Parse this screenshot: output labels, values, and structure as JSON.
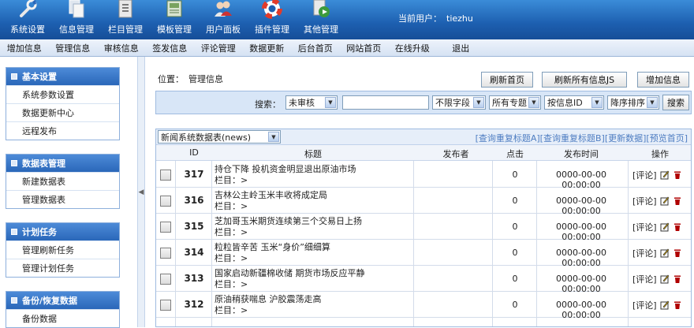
{
  "top_nav": [
    {
      "label": "系统设置",
      "icon": "wrench-icon"
    },
    {
      "label": "信息管理",
      "icon": "documents-icon"
    },
    {
      "label": "栏目管理",
      "icon": "column-icon"
    },
    {
      "label": "模板管理",
      "icon": "template-icon"
    },
    {
      "label": "用户面板",
      "icon": "users-icon"
    },
    {
      "label": "插件管理",
      "icon": "lifebuoy-icon"
    },
    {
      "label": "其他管理",
      "icon": "media-icon"
    }
  ],
  "user": {
    "label": "当前用户：",
    "name": "tiezhu"
  },
  "sub_menu": [
    "增加信息",
    "管理信息",
    "审核信息",
    "签发信息",
    "评论管理",
    "数据更新",
    "后台首页",
    "网站首页",
    "在线升级",
    "退出"
  ],
  "sidebar": [
    {
      "title": "基本设置",
      "items": [
        "系统参数设置",
        "数据更新中心",
        "远程发布"
      ]
    },
    {
      "title": "数据表管理",
      "items": [
        "新建数据表",
        "管理数据表"
      ]
    },
    {
      "title": "计划任务",
      "items": [
        "管理刷新任务",
        "管理计划任务"
      ]
    },
    {
      "title": "备份/恢复数据",
      "items": [
        "备份数据"
      ]
    }
  ],
  "breadcrumb": {
    "label": "位置：",
    "current": "管理信息"
  },
  "actions": {
    "refresh_home": "刷新首页",
    "refresh_js": "刷新所有信息JS",
    "add_info": "增加信息"
  },
  "search": {
    "label": "搜索：",
    "status": "未审核",
    "query": "",
    "field": "不限字段",
    "topic": "所有专题",
    "sort_by": "按信息ID",
    "order": "降序排序",
    "button": "搜索"
  },
  "table_select": "新闻系统数据表(news)",
  "panel_links": [
    "[查询重复标题A]",
    "[查询重复标题B]",
    "[更新数据]",
    "[预览首页]"
  ],
  "columns": {
    "id": "ID",
    "title": "标题",
    "author": "发布者",
    "clicks": "点击",
    "time": "发布时间",
    "ops": "操作"
  },
  "rows": [
    {
      "id": "317",
      "title": "持仓下降 投机资金明显退出原油市场",
      "column": "栏目：>",
      "clicks": "0",
      "time": "0000-00-00 00:00:00",
      "comment": "[评论]"
    },
    {
      "id": "316",
      "title": "吉林公主岭玉米丰收将成定局",
      "column": "栏目：>",
      "clicks": "0",
      "time": "0000-00-00 00:00:00",
      "comment": "[评论]"
    },
    {
      "id": "315",
      "title": "芝加哥玉米期货连续第三个交易日上扬",
      "column": "栏目：>",
      "clicks": "0",
      "time": "0000-00-00 00:00:00",
      "comment": "[评论]"
    },
    {
      "id": "314",
      "title": "粒粒皆辛苦 玉米“身价”细细算",
      "column": "栏目：>",
      "clicks": "0",
      "time": "0000-00-00 00:00:00",
      "comment": "[评论]"
    },
    {
      "id": "313",
      "title": "国家启动新疆棉收储 期货市场反应平静",
      "column": "栏目：>",
      "clicks": "0",
      "time": "0000-00-00 00:00:00",
      "comment": "[评论]"
    },
    {
      "id": "312",
      "title": "原油稍获喘息 沪胶震荡走高",
      "column": "栏目：>",
      "clicks": "0",
      "time": "0000-00-00 00:00:00",
      "comment": "[评论]"
    }
  ],
  "colors": {
    "header": "#1d5fb0",
    "sidebar_head": "#2a67b9",
    "searchbar": "#d8e6f7",
    "link": "#4f7ec2",
    "delete": "#b00000"
  }
}
